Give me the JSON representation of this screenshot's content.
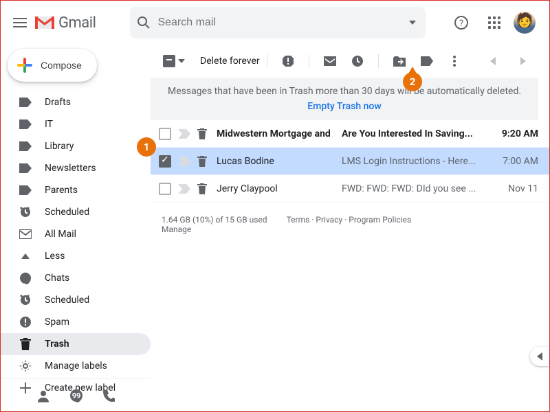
{
  "header": {
    "product": "Gmail",
    "search_placeholder": "Search mail"
  },
  "compose_label": "Compose",
  "sidebar": {
    "items": [
      {
        "icon": "label",
        "label": "Drafts"
      },
      {
        "icon": "label",
        "label": "IT"
      },
      {
        "icon": "label",
        "label": "Library"
      },
      {
        "icon": "label",
        "label": "Newsletters"
      },
      {
        "icon": "label",
        "label": "Parents"
      },
      {
        "icon": "scheduled",
        "label": "Scheduled"
      },
      {
        "icon": "allmail",
        "label": "All Mail"
      },
      {
        "icon": "less",
        "label": "Less"
      },
      {
        "icon": "chats",
        "label": "Chats"
      },
      {
        "icon": "scheduled",
        "label": "Scheduled"
      },
      {
        "icon": "spam",
        "label": "Spam"
      },
      {
        "icon": "trash",
        "label": "Trash",
        "current": true
      },
      {
        "icon": "gear",
        "label": "Manage labels"
      },
      {
        "icon": "plus",
        "label": "Create new label"
      }
    ]
  },
  "toolbar": {
    "delete_forever": "Delete forever"
  },
  "banner": {
    "text": "Messages that have been in Trash more than 30 days will be automatically deleted.",
    "action": "Empty Trash now"
  },
  "messages": [
    {
      "sender": "Midwestern Mortgage and",
      "subject": "Are You Interested In Saving...",
      "time": "9:20 AM",
      "unread": true,
      "selected": false
    },
    {
      "sender": "Lucas Bodine",
      "subject": "LMS Login Instructions - Here...",
      "time": "7:00 AM",
      "unread": false,
      "selected": true
    },
    {
      "sender": "Jerry Claypool",
      "subject": "FWD: FWD: FWD: DId you see ...",
      "time": "Nov 11",
      "unread": false,
      "selected": false
    }
  ],
  "footer": {
    "storage": "1.64 GB (10%) of 15 GB used",
    "manage": "Manage",
    "terms": "Terms",
    "privacy": "Privacy",
    "policies": "Program Policies"
  },
  "callouts": {
    "one": "1",
    "two": "2"
  }
}
